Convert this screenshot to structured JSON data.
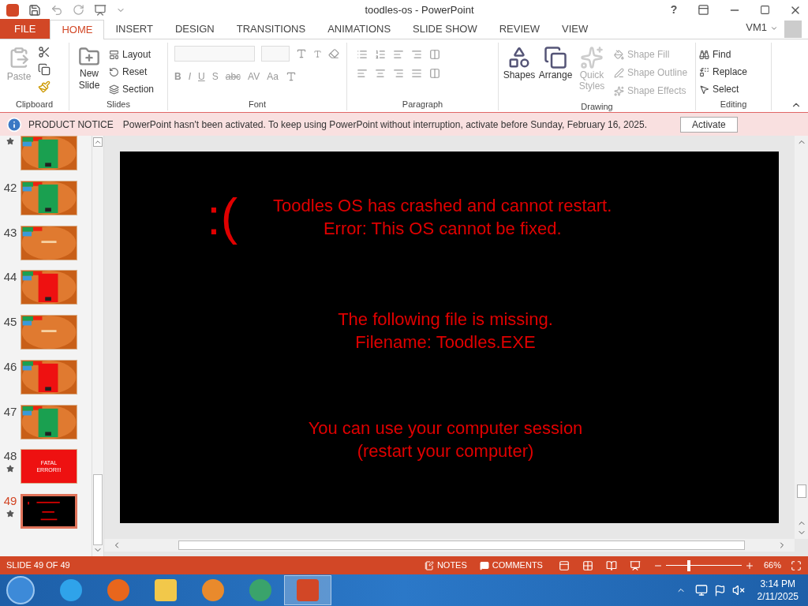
{
  "window": {
    "title": "toodles-os - PowerPoint",
    "help": "?",
    "account": "VM1"
  },
  "tabs": [
    {
      "label": "FILE",
      "kind": "file",
      "selected": false
    },
    {
      "label": "HOME",
      "kind": "tab",
      "selected": true
    },
    {
      "label": "INSERT",
      "kind": "tab",
      "selected": false
    },
    {
      "label": "DESIGN",
      "kind": "tab",
      "selected": false
    },
    {
      "label": "TRANSITIONS",
      "kind": "tab",
      "selected": false
    },
    {
      "label": "ANIMATIONS",
      "kind": "tab",
      "selected": false
    },
    {
      "label": "SLIDE SHOW",
      "kind": "tab",
      "selected": false
    },
    {
      "label": "REVIEW",
      "kind": "tab",
      "selected": false
    },
    {
      "label": "VIEW",
      "kind": "tab",
      "selected": false
    }
  ],
  "ribbon": {
    "clipboard": {
      "label": "Clipboard",
      "paste": {
        "label": "Paste",
        "disabled": true
      }
    },
    "slides": {
      "label": "Slides",
      "new_slide": [
        "New",
        "Slide"
      ],
      "items": [
        "Layout",
        "Reset",
        "Section"
      ]
    },
    "font": {
      "label": "Font",
      "format_buttons": [
        "B",
        "I",
        "U",
        "S",
        "abc",
        "AV",
        "Aa"
      ]
    },
    "paragraph": {
      "label": "Paragraph"
    },
    "drawing": {
      "label": "Drawing",
      "large": [
        {
          "label": "Shapes",
          "disabled": false
        },
        {
          "label": "Arrange",
          "disabled": false
        },
        {
          "label": "Quick Styles",
          "disabled": true
        }
      ],
      "small": [
        "Shape Fill",
        "Shape Outline",
        "Shape Effects"
      ]
    },
    "editing": {
      "label": "Editing",
      "items": [
        "Find",
        "Replace",
        "Select"
      ]
    }
  },
  "notice": {
    "title": "PRODUCT NOTICE",
    "message": "PowerPoint hasn't been activated. To keep using PowerPoint without interruption, activate before Sunday, February 16, 2025.",
    "button": "Activate"
  },
  "thumbnails": [
    {
      "kind": "green",
      "starred": true,
      "selected": false
    },
    {
      "number": "42",
      "kind": "green",
      "starred": false,
      "selected": false
    },
    {
      "number": "43",
      "kind": "title",
      "starred": false,
      "selected": false
    },
    {
      "number": "44",
      "kind": "red",
      "starred": false,
      "selected": false
    },
    {
      "number": "45",
      "kind": "title",
      "starred": false,
      "selected": false
    },
    {
      "number": "46",
      "kind": "red",
      "starred": false,
      "selected": false
    },
    {
      "number": "47",
      "kind": "green",
      "starred": false,
      "selected": false
    },
    {
      "number": "48",
      "kind": "fatal",
      "text": "FATAL ERROR!!!",
      "starred": true,
      "selected": false
    },
    {
      "number": "49",
      "kind": "crash",
      "starred": true,
      "selected": true
    }
  ],
  "slide": {
    "face": ":(",
    "blocks": [
      [
        "Toodles OS has crashed and cannot restart.",
        "Error: This OS cannot be fixed."
      ],
      [
        "The following file is missing.",
        "Filename: Toodles.EXE"
      ],
      [
        "You can use your computer session",
        "(restart your computer)"
      ]
    ]
  },
  "status_bar": {
    "slide_counter": "SLIDE 49 OF 49",
    "notes": "NOTES",
    "comments": "COMMENTS",
    "zoom": {
      "level": 0.3,
      "reading": "66%"
    }
  },
  "taskbar": {
    "apps": [
      {
        "kind": "ie",
        "selected": false
      },
      {
        "kind": "firefox",
        "selected": false
      },
      {
        "kind": "explorer",
        "selected": false
      },
      {
        "kind": "media",
        "selected": false
      },
      {
        "kind": "messenger",
        "selected": false
      },
      {
        "kind": "powerpoint",
        "selected": true
      }
    ],
    "time": "3:14 PM",
    "date": "2/11/2025"
  }
}
